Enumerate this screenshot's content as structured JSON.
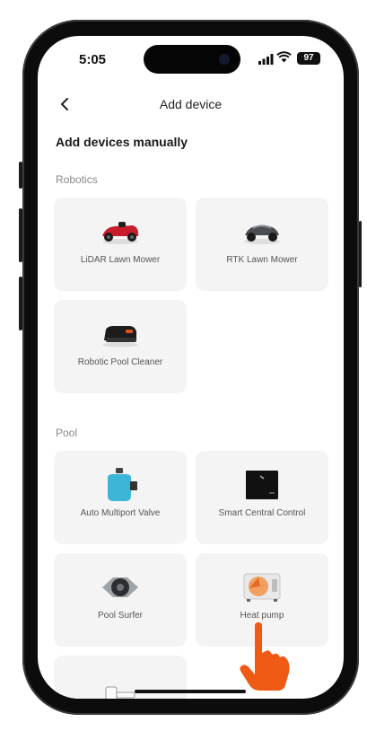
{
  "status_bar": {
    "time": "5:05",
    "battery": "97"
  },
  "nav": {
    "title": "Add device"
  },
  "section_title": "Add devices manually",
  "categories": [
    {
      "name": "Robotics",
      "devices": [
        {
          "label": "LiDAR Lawn Mower",
          "icon": "lidar-mower-icon"
        },
        {
          "label": "RTK Lawn Mower",
          "icon": "rtk-mower-icon"
        },
        {
          "label": "Robotic Pool Cleaner",
          "icon": "pool-cleaner-icon"
        }
      ]
    },
    {
      "name": "Pool",
      "devices": [
        {
          "label": "Auto Multiport Valve",
          "icon": "multiport-valve-icon"
        },
        {
          "label": "Smart Central Control",
          "icon": "central-control-icon"
        },
        {
          "label": "Pool Surfer",
          "icon": "pool-surfer-icon"
        },
        {
          "label": "Heat pump",
          "icon": "heat-pump-icon"
        }
      ]
    }
  ],
  "colors": {
    "card_bg": "#f4f4f4",
    "hand": "#ef5a14",
    "mower_red": "#c81e2b"
  }
}
